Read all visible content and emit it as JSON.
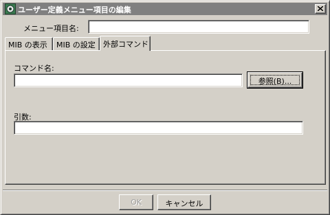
{
  "window": {
    "title": "ユーザー定義メニュー項目の編集"
  },
  "menu_item_name": {
    "label": "メニュー項目名:",
    "value": ""
  },
  "tabs": [
    {
      "label": "MIB の表示",
      "active": false
    },
    {
      "label": "MIB の設定",
      "active": false
    },
    {
      "label": "外部コマンド",
      "active": true
    }
  ],
  "external_command": {
    "command_label": "コマンド名:",
    "command_value": "",
    "browse_label": "参照(B)...",
    "args_label": "引数:",
    "args_value": ""
  },
  "footer": {
    "ok_label": "OK",
    "cancel_label": "キャンセル"
  },
  "colors": {
    "face": "#d4d0c8",
    "titlebar": "#808080"
  }
}
